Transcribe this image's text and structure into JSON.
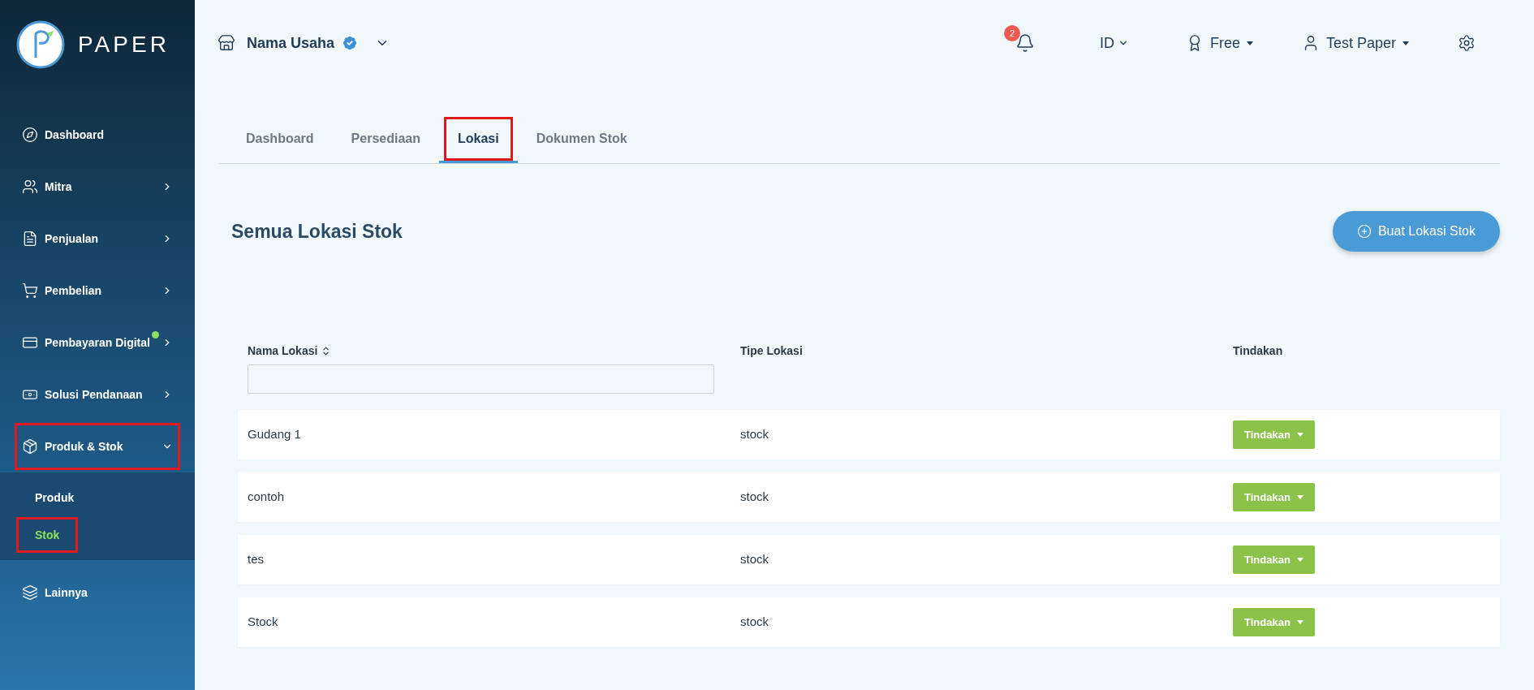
{
  "brand": {
    "name": "PAPER"
  },
  "sidebar": {
    "items": [
      {
        "label": "Dashboard",
        "kind": "link",
        "highlighted": false
      },
      {
        "label": "Mitra",
        "kind": "group",
        "expanded": false,
        "highlighted": false
      },
      {
        "label": "Penjualan",
        "kind": "group",
        "expanded": false,
        "highlighted": false
      },
      {
        "label": "Pembelian",
        "kind": "group",
        "expanded": false,
        "highlighted": false
      },
      {
        "label": "Pembayaran Digital",
        "kind": "group",
        "expanded": false,
        "highlighted": false,
        "new": true
      },
      {
        "label": "Solusi Pendanaan",
        "kind": "group",
        "expanded": false,
        "highlighted": false
      },
      {
        "label": "Produk & Stok",
        "kind": "group",
        "expanded": true,
        "highlighted": true,
        "children": [
          {
            "label": "Produk",
            "selected": false,
            "highlighted": false
          },
          {
            "label": "Stok",
            "selected": true,
            "highlighted": true
          }
        ]
      },
      {
        "label": "Lainnya",
        "kind": "link",
        "highlighted": false
      }
    ]
  },
  "topbar": {
    "business": "Nama Usaha",
    "verified": true,
    "notifications": "2",
    "language": "ID",
    "plan": "Free",
    "user": "Test Paper"
  },
  "tabs": [
    {
      "label": "Dashboard",
      "selected": false,
      "highlighted": false
    },
    {
      "label": "Persediaan",
      "selected": false,
      "highlighted": false
    },
    {
      "label": "Lokasi",
      "selected": true,
      "highlighted": true
    },
    {
      "label": "Dokumen Stok",
      "selected": false,
      "highlighted": false
    }
  ],
  "page": {
    "title": "Semua Lokasi Stok",
    "create_button": "Buat Lokasi Stok"
  },
  "table": {
    "columns": [
      "Nama Lokasi",
      "Tipe Lokasi",
      "Tindakan"
    ],
    "rows": [
      {
        "name": "Gudang 1",
        "type": "stock",
        "action": "Tindakan"
      },
      {
        "name": "contoh",
        "type": "stock",
        "action": "Tindakan"
      },
      {
        "name": "tes",
        "type": "stock",
        "action": "Tindakan"
      },
      {
        "name": "Stock",
        "type": "stock",
        "action": "Tindakan"
      }
    ]
  }
}
